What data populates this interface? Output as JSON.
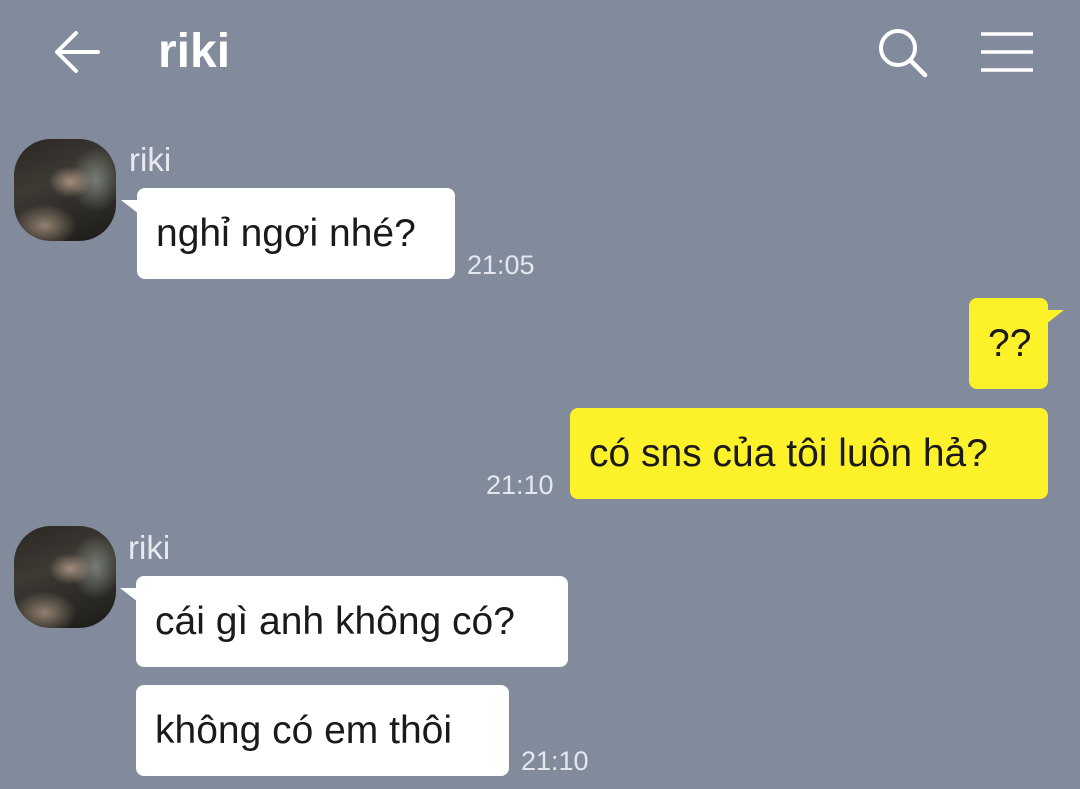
{
  "header": {
    "title": "riki",
    "back_icon": "arrow-left-icon",
    "search_icon": "search-icon",
    "menu_icon": "hamburger-menu-icon"
  },
  "colors": {
    "background": "#828b9c",
    "incoming_bubble": "#ffffff",
    "outgoing_bubble": "#fdf129"
  },
  "messages": [
    {
      "sender": "riki",
      "direction": "incoming",
      "text": "nghỉ ngơi nhé?",
      "time": "21:05"
    },
    {
      "direction": "outgoing",
      "text": "??"
    },
    {
      "direction": "outgoing",
      "text": "có sns của tôi luôn hả?",
      "time": "21:10"
    },
    {
      "sender": "riki",
      "direction": "incoming",
      "text": "cái gì anh không có?"
    },
    {
      "direction": "incoming",
      "text": "không có em thôi",
      "time": "21:10"
    }
  ]
}
